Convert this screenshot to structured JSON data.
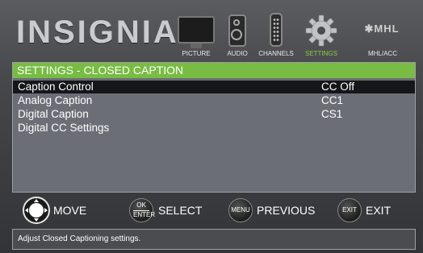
{
  "brand": {
    "logo_text": "INSIGNIA"
  },
  "nav": {
    "items": [
      {
        "label": "PICTURE",
        "icon": "tv-icon",
        "active": false
      },
      {
        "label": "AUDIO",
        "icon": "speaker-icon",
        "active": false
      },
      {
        "label": "CHANNELS",
        "icon": "remote-icon",
        "active": false
      },
      {
        "label": "SETTINGS",
        "icon": "gear-icon",
        "active": true
      },
      {
        "label": "MHL/ACC",
        "icon": "mhl-icon",
        "active": false,
        "icon_text": "✱MHL"
      }
    ]
  },
  "panel": {
    "title": "SETTINGS - CLOSED CAPTION",
    "rows": [
      {
        "label": "Caption Control",
        "value": "CC Off",
        "selected": true
      },
      {
        "label": "Analog Caption",
        "value": "CC1",
        "selected": false
      },
      {
        "label": "Digital Caption",
        "value": "CS1",
        "selected": false
      },
      {
        "label": "Digital CC Settings",
        "value": "",
        "selected": false
      }
    ]
  },
  "hints": {
    "move": {
      "label": "MOVE"
    },
    "select": {
      "button_top": "OK",
      "button_bottom": "ENTER",
      "label": "SELECT"
    },
    "previous": {
      "button": "MENU",
      "label": "PREVIOUS"
    },
    "exit": {
      "button": "EXIT",
      "label": "EXIT"
    }
  },
  "help": {
    "text": "Adjust Closed Captioning settings."
  },
  "colors": {
    "accent": "#78bc43",
    "selected_row": "#15161a",
    "panel_bg": "#6b6e75"
  }
}
